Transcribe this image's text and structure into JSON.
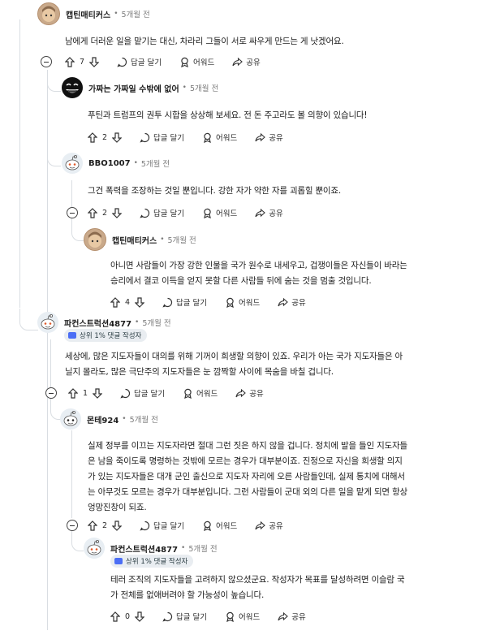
{
  "actions": {
    "reply_label": "답글 달기",
    "award_label": "어워드",
    "share_label": "공유"
  },
  "comments": [
    {
      "author": "캡틴매티커스",
      "time": "5개월 전",
      "text": [
        "남에게 더러운 일을 맡기는 대신, 차라리 그들이 서로 싸우게 만드는 게 낫겠어요."
      ],
      "votes": "7",
      "avatar": "cat-avatar"
    },
    {
      "author": "가짜는 가짜일 수밖에 없어",
      "time": "5개월 전",
      "text": [
        "푸틴과 트럼프의 권투 시합을 상상해 보세요. 전 돈 주고라도 볼 의향이 있습니다!"
      ],
      "votes": "2",
      "avatar": "dark-face-avatar"
    },
    {
      "author": "BBO1007",
      "time": "5개월 전",
      "text": [
        "그건 폭력을 조장하는 것일 뿐입니다. 강한 자가 약한 자를 괴롭힐 뿐이죠."
      ],
      "votes": "2",
      "avatar": "snoo-avatar"
    },
    {
      "author": "캡틴매티커스",
      "time": "5개월 전",
      "text": [
        "아니면 사람들이 가장 강한 인물을 국가 원수로 내세우고, 겁쟁이들은 자신들이 바라는",
        "승리에서 결코 이득을 얻지 못할 다른 사람들 뒤에 숨는 것을 멈출 것입니다."
      ],
      "votes": "4",
      "avatar": "cat-avatar"
    },
    {
      "author": "파컨스트럭션4877",
      "time": "5개월 전",
      "flair": "상위 1% 댓글 작성자",
      "text": [
        "세상에, 많은 지도자들이 대의를 위해 기꺼이 희생할 의향이 있죠. 우리가 아는 국가 지도자들은 아",
        "닐지 몰라도, 많은 극단주의 지도자들은 눈 깜짝할 사이에 목숨을 바칠 겁니다."
      ],
      "votes": "1",
      "avatar": "snoo-avatar"
    },
    {
      "author": "몬테924",
      "time": "5개월 전",
      "text": [
        "실제 정부를 이끄는 지도자라면 절대 그런 짓은 하지 않을 겁니다. 정치에 발을 들인 지도자들",
        "은 남을 죽이도록 명령하는 것밖에 모르는 경우가 대부분이죠. 진정으로 자신을 희생할 의지",
        "가 있는 지도자들은 대개 군인 출신으로 지도자 자리에 오른 사람들인데, 실제 통치에 대해서",
        "는 아무것도 모르는 경우가 대부분입니다. 그런 사람들이 군대 외의 다른 일을 맡게 되면 항상",
        "엉망진창이 되죠."
      ],
      "votes": "2",
      "avatar": "snoo-avatar"
    },
    {
      "author": "파컨스트럭션4877",
      "time": "5개월 전",
      "flair": "상위 1% 댓글 작성자",
      "text": [
        "테러 조직의 지도자들을 고려하지 않으셨군요. 작성자가 목표를 달성하려면 이슬람 국",
        "가 전체를 없애버려야 할 가능성이 높습니다."
      ],
      "votes": "0",
      "avatar": "snoo-avatar"
    }
  ]
}
